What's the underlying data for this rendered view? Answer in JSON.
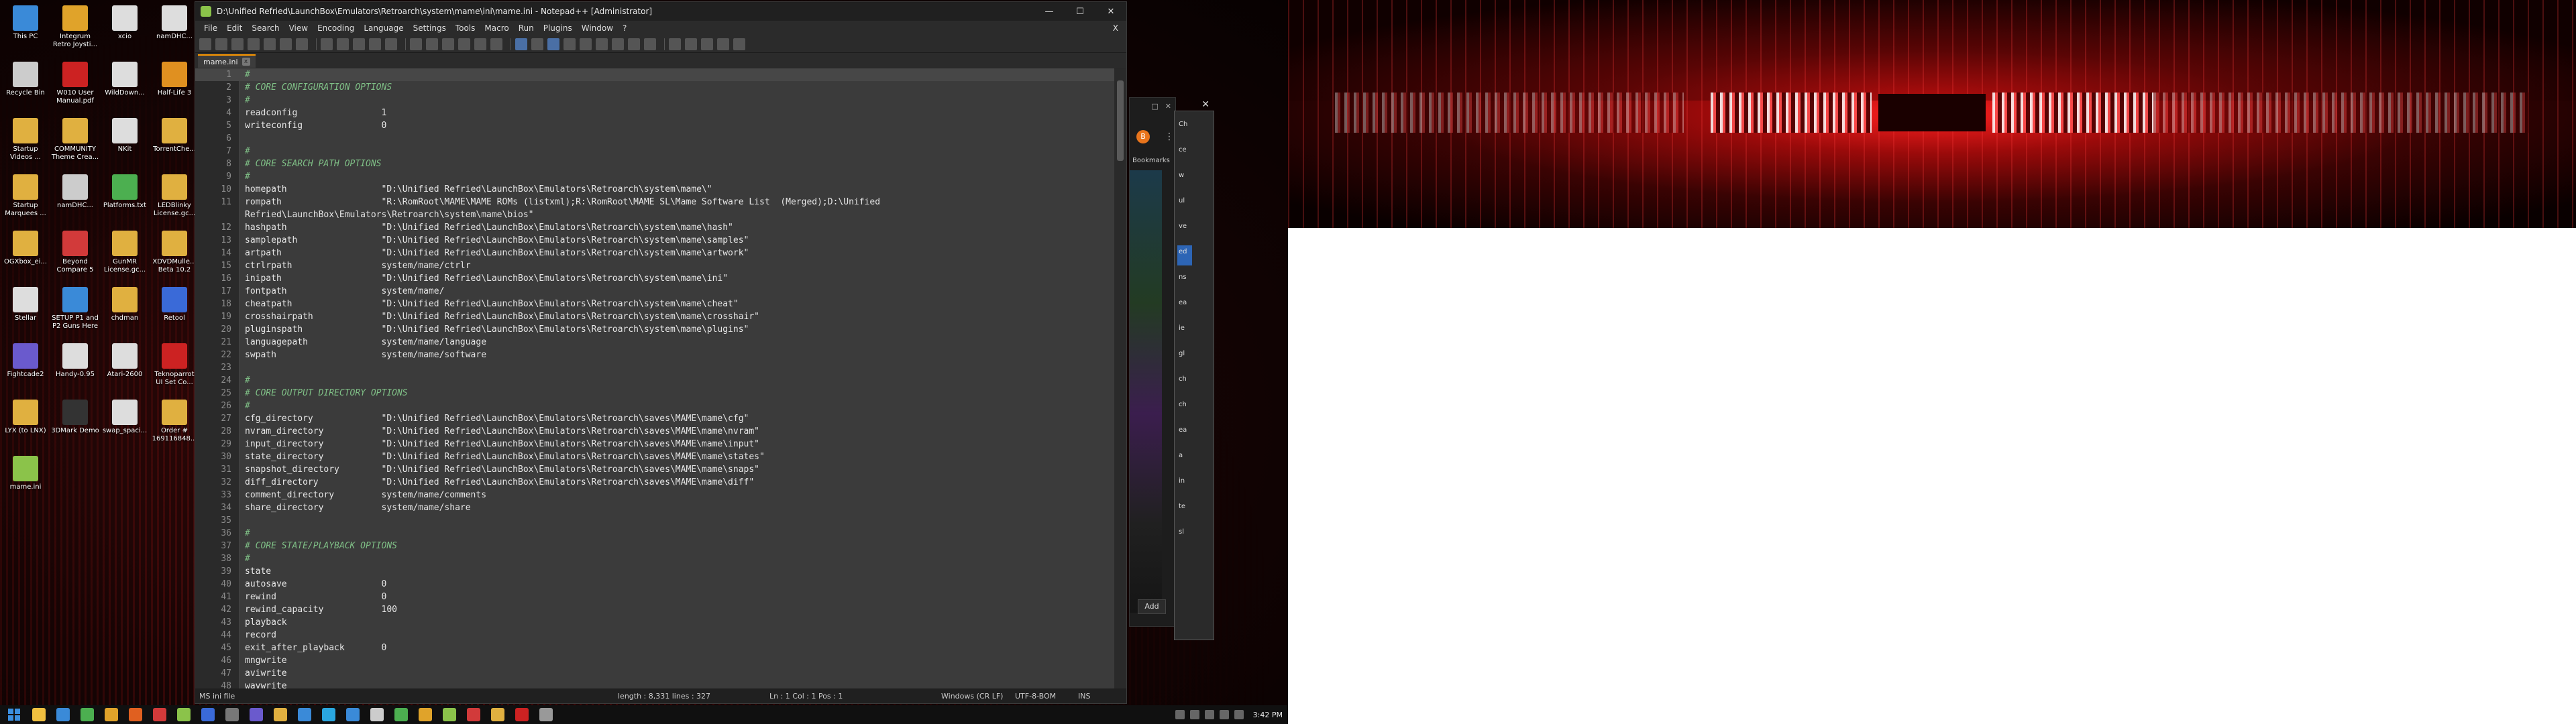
{
  "desktop_icons": [
    {
      "label": "This PC",
      "color": "#3a8ad8"
    },
    {
      "label": "Integrum Retro Joysti...",
      "color": "#e0a32a"
    },
    {
      "label": "xcio",
      "color": "#dddddd"
    },
    {
      "label": "namDHC...",
      "color": "#dddddd"
    },
    {
      "label": "Recycle Bin",
      "color": "#cccccc"
    },
    {
      "label": "W010 User Manual.pdf",
      "color": "#cc2222"
    },
    {
      "label": "WildDown...",
      "color": "#dddddd"
    },
    {
      "label": "Half-Life 3",
      "color": "#e09020"
    },
    {
      "label": "Startup Videos ...",
      "color": "#e0b040"
    },
    {
      "label": "COMMUNITY Theme Crea...",
      "color": "#e0b040"
    },
    {
      "label": "NKit",
      "color": "#dddddd"
    },
    {
      "label": "TorrentChe...",
      "color": "#e0b040"
    },
    {
      "label": "Startup Marquees ...",
      "color": "#e0b040"
    },
    {
      "label": "namDHC...",
      "color": "#cccccc"
    },
    {
      "label": "Platforms.txt",
      "color": "#4caf50"
    },
    {
      "label": "LEDBlinky License.gc...",
      "color": "#e0b040"
    },
    {
      "label": "OGXbox_ei...",
      "color": "#e0b040"
    },
    {
      "label": "Beyond Compare 5",
      "color": "#d23a3a"
    },
    {
      "label": "GunMR License.gc...",
      "color": "#e0b040"
    },
    {
      "label": "XDVDMulle... Beta 10.2",
      "color": "#e0b040"
    },
    {
      "label": "Stellar",
      "color": "#dddddd"
    },
    {
      "label": "SETUP P1 and P2 Guns Here",
      "color": "#3a8ad8"
    },
    {
      "label": "chdman",
      "color": "#e0b040"
    },
    {
      "label": "Retool",
      "color": "#3a6ad8"
    },
    {
      "label": "Fightcade2",
      "color": "#6a5acd"
    },
    {
      "label": "Handy-0.95",
      "color": "#dddddd"
    },
    {
      "label": "Atari-2600",
      "color": "#dddddd"
    },
    {
      "label": "Teknoparrot UI Set Co...",
      "color": "#cc2222"
    },
    {
      "label": "LYX (to LNX)",
      "color": "#e0b040"
    },
    {
      "label": "3DMark Demo",
      "color": "#333333"
    },
    {
      "label": "swap_spaci...",
      "color": "#dddddd"
    },
    {
      "label": "Order # 169116848...",
      "color": "#e0b040"
    },
    {
      "label": "mame.ini",
      "color": "#8bc34a"
    }
  ],
  "npp": {
    "title": "D:\\Unified Refried\\LaunchBox\\Emulators\\Retroarch\\system\\mame\\ini\\mame.ini - Notepad++ [Administrator]",
    "menu": [
      "File",
      "Edit",
      "Search",
      "View",
      "Encoding",
      "Language",
      "Settings",
      "Tools",
      "Macro",
      "Run",
      "Plugins",
      "Window",
      "?"
    ],
    "menu_close": "X",
    "tab": "mame.ini",
    "tab_close": "x",
    "win_min": "—",
    "win_max": "☐",
    "win_close": "✕",
    "lines": [
      {
        "n": "1",
        "t": "#",
        "c": true
      },
      {
        "n": "2",
        "t": "# CORE CONFIGURATION OPTIONS",
        "c": true
      },
      {
        "n": "3",
        "t": "#",
        "c": true
      },
      {
        "n": "4",
        "t": "readconfig                1",
        "c": false
      },
      {
        "n": "5",
        "t": "writeconfig               0",
        "c": false
      },
      {
        "n": "6",
        "t": "",
        "c": false
      },
      {
        "n": "7",
        "t": "#",
        "c": true
      },
      {
        "n": "8",
        "t": "# CORE SEARCH PATH OPTIONS",
        "c": true
      },
      {
        "n": "9",
        "t": "#",
        "c": true
      },
      {
        "n": "10",
        "t": "homepath                  \"D:\\Unified Refried\\LaunchBox\\Emulators\\Retroarch\\system\\mame\\\"",
        "c": false
      },
      {
        "n": "11",
        "t": "rompath                   \"R:\\RomRoot\\MAME\\MAME ROMs (listxml);R:\\RomRoot\\MAME SL\\Mame Software List  (Merged);D:\\Unified",
        "c": false
      },
      {
        "n": "",
        "t": "Refried\\LaunchBox\\Emulators\\Retroarch\\system\\mame\\bios\"",
        "c": false
      },
      {
        "n": "12",
        "t": "hashpath                  \"D:\\Unified Refried\\LaunchBox\\Emulators\\Retroarch\\system\\mame\\hash\"",
        "c": false
      },
      {
        "n": "13",
        "t": "samplepath                \"D:\\Unified Refried\\LaunchBox\\Emulators\\Retroarch\\system\\mame\\samples\"",
        "c": false
      },
      {
        "n": "14",
        "t": "artpath                   \"D:\\Unified Refried\\LaunchBox\\Emulators\\Retroarch\\system\\mame\\artwork\"",
        "c": false
      },
      {
        "n": "15",
        "t": "ctrlrpath                 system/mame/ctrlr",
        "c": false
      },
      {
        "n": "16",
        "t": "inipath                   \"D:\\Unified Refried\\LaunchBox\\Emulators\\Retroarch\\system\\mame\\ini\"",
        "c": false
      },
      {
        "n": "17",
        "t": "fontpath                  system/mame/",
        "c": false
      },
      {
        "n": "18",
        "t": "cheatpath                 \"D:\\Unified Refried\\LaunchBox\\Emulators\\Retroarch\\system\\mame\\cheat\"",
        "c": false
      },
      {
        "n": "19",
        "t": "crosshairpath             \"D:\\Unified Refried\\LaunchBox\\Emulators\\Retroarch\\system\\mame\\crosshair\"",
        "c": false
      },
      {
        "n": "20",
        "t": "pluginspath               \"D:\\Unified Refried\\LaunchBox\\Emulators\\Retroarch\\system\\mame\\plugins\"",
        "c": false
      },
      {
        "n": "21",
        "t": "languagepath              system/mame/language",
        "c": false
      },
      {
        "n": "22",
        "t": "swpath                    system/mame/software",
        "c": false
      },
      {
        "n": "23",
        "t": "",
        "c": false
      },
      {
        "n": "24",
        "t": "#",
        "c": true
      },
      {
        "n": "25",
        "t": "# CORE OUTPUT DIRECTORY OPTIONS",
        "c": true
      },
      {
        "n": "26",
        "t": "#",
        "c": true
      },
      {
        "n": "27",
        "t": "cfg_directory             \"D:\\Unified Refried\\LaunchBox\\Emulators\\Retroarch\\saves\\MAME\\mame\\cfg\"",
        "c": false
      },
      {
        "n": "28",
        "t": "nvram_directory           \"D:\\Unified Refried\\LaunchBox\\Emulators\\Retroarch\\saves\\MAME\\mame\\nvram\"",
        "c": false
      },
      {
        "n": "29",
        "t": "input_directory           \"D:\\Unified Refried\\LaunchBox\\Emulators\\Retroarch\\saves\\MAME\\mame\\input\"",
        "c": false
      },
      {
        "n": "30",
        "t": "state_directory           \"D:\\Unified Refried\\LaunchBox\\Emulators\\Retroarch\\saves\\MAME\\mame\\states\"",
        "c": false
      },
      {
        "n": "31",
        "t": "snapshot_directory        \"D:\\Unified Refried\\LaunchBox\\Emulators\\Retroarch\\saves\\MAME\\mame\\snaps\"",
        "c": false
      },
      {
        "n": "32",
        "t": "diff_directory            \"D:\\Unified Refried\\LaunchBox\\Emulators\\Retroarch\\saves\\MAME\\mame\\diff\"",
        "c": false
      },
      {
        "n": "33",
        "t": "comment_directory         system/mame/comments",
        "c": false
      },
      {
        "n": "34",
        "t": "share_directory           system/mame/share",
        "c": false
      },
      {
        "n": "35",
        "t": "",
        "c": false
      },
      {
        "n": "36",
        "t": "#",
        "c": true
      },
      {
        "n": "37",
        "t": "# CORE STATE/PLAYBACK OPTIONS",
        "c": true
      },
      {
        "n": "38",
        "t": "#",
        "c": true
      },
      {
        "n": "39",
        "t": "state",
        "c": false
      },
      {
        "n": "40",
        "t": "autosave                  0",
        "c": false
      },
      {
        "n": "41",
        "t": "rewind                    0",
        "c": false
      },
      {
        "n": "42",
        "t": "rewind_capacity           100",
        "c": false
      },
      {
        "n": "43",
        "t": "playback",
        "c": false
      },
      {
        "n": "44",
        "t": "record",
        "c": false
      },
      {
        "n": "45",
        "t": "exit_after_playback       0",
        "c": false
      },
      {
        "n": "46",
        "t": "mngwrite",
        "c": false
      },
      {
        "n": "47",
        "t": "aviwrite",
        "c": false
      },
      {
        "n": "48",
        "t": "wavwrite",
        "c": false
      }
    ],
    "status": {
      "filetype": "MS ini file",
      "length": "length : 8,331    lines : 327",
      "position": "Ln : 1    Col : 1    Pos : 1",
      "eol": "Windows (CR LF)",
      "encoding": "UTF-8-BOM",
      "mode": "INS"
    }
  },
  "panel": {
    "avatar": "B",
    "menu_dots": "⋮",
    "bookmarks": "Bookmarks",
    "add": "Add",
    "ctl1": "□",
    "ctl2": "✕"
  },
  "sidewin": {
    "close": "✕",
    "items": [
      "Ch",
      "ce",
      "w",
      "ul",
      "ve",
      "ed",
      "ns",
      "ea",
      "ie",
      "gl",
      "ch",
      "ch",
      "ea",
      "a",
      "in",
      "te",
      "sl"
    ]
  },
  "taskbar": {
    "time": "3:42 PM",
    "apps": [
      "#f0c040",
      "#3a8ad8",
      "#4caf50",
      "#e0a32a",
      "#e06020",
      "#d23a3a",
      "#8bc34a",
      "#3a6ad8",
      "#777777",
      "#6a5acd",
      "#e0b040",
      "#3a8ad8",
      "#2aa7e0",
      "#3a8ad8",
      "#cccccc",
      "#4caf50",
      "#e0a32a",
      "#8bc34a",
      "#d23a3a",
      "#e0b040",
      "#cc2222",
      "#999999"
    ]
  }
}
